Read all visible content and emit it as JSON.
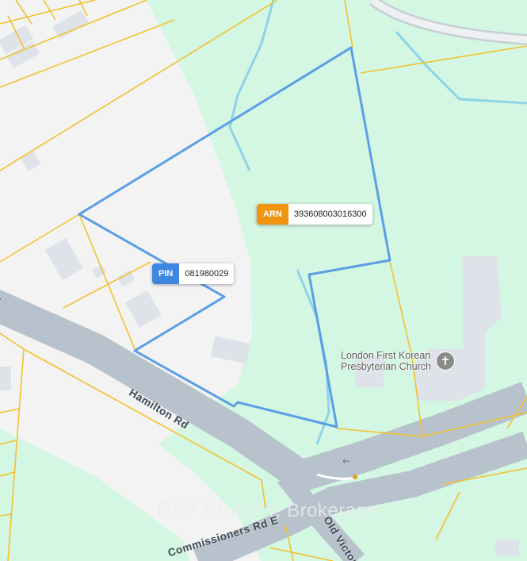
{
  "parcels": [
    {
      "key": "PIN",
      "value": "081980029",
      "color": "#3f86e0"
    },
    {
      "key": "ARN",
      "value": "393608003016300",
      "color": "#f0950f"
    }
  ],
  "poi": {
    "name_line1": "London First Korean",
    "name_line2": "Presbyterian Church",
    "icon": "cross-icon",
    "icon_glyph": "✝"
  },
  "roads": {
    "hamilton": "Hamilton Rd",
    "commissioners": "Commissioners Rd E",
    "old_victoria": "Old Victori",
    "cutoff_left": "d"
  },
  "watermark": "EXP REALTY, Brokerage",
  "colors": {
    "park": "#d3f7e2",
    "land": "#f3f3f3",
    "road": "#b8c2cc",
    "lot_line": "#f2c12e",
    "boundary": "#5b9ee6",
    "water": "#8ed3e8",
    "building": "#dde3e8"
  }
}
